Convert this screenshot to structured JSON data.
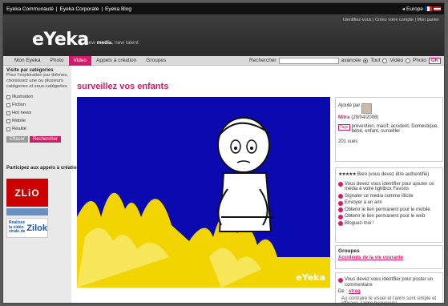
{
  "topbar": {
    "links": [
      "Eyeka Communauté",
      "Eyeka Corporate",
      "Eyeka Blog"
    ],
    "region": "Europe"
  },
  "header": {
    "account_text": "Identifiez-vous | Créez votre compte  | Mon panier",
    "logo": "eYeka",
    "tagline_pre": "new",
    "tagline_b": "media",
    "tagline_post": ", new talent"
  },
  "nav": {
    "tabs": [
      "Mon Eyeka",
      "Photo",
      "Video",
      "Appels à création",
      "Groupes"
    ],
    "search_label": "Rechercher",
    "advanced": "avancée",
    "opts": [
      "Tout",
      "Vidéo",
      "Photo"
    ],
    "ok": "OK"
  },
  "sidebar": {
    "heading": "Visite par catégories",
    "desc": "Pour l'exploration par thèmes, choisissez une ou plusieurs catégories et sous-catégories",
    "cats": [
      "Illustration",
      "Fiction",
      "Hot news",
      "Mobile",
      "Réalité"
    ],
    "reset": "Effacer",
    "search": "Rechercher",
    "appeals": "Participez aux appels à création du moment",
    "ad1": "ZLiO",
    "ad3a": "Réalisez la vidéo virale de",
    "ad3b": "Zilok"
  },
  "main": {
    "title": "surveillez vos enfants",
    "video_watermark": "eYeka"
  },
  "info": {
    "added_by": "Ajouté par",
    "author": "Mitra",
    "date": "(29/04/2008)",
    "tags_badge": "Tags",
    "tags": "prévention, macif, accident, Domestique, bébé, enfant, surveiller",
    "views": "201 vues"
  },
  "actions": {
    "rating_text": "Bien (vous devez être authentifié)",
    "items": [
      "Vous devez vous identifier pour ajouter ce média à votre lightbox Favoris",
      "Signaler ce media comme illicite",
      "Envoyer à un ami",
      "Obtenir le lien permanent pour le mobile",
      "Obtenir le lien permanent pour le web",
      "Bloguez-moi !"
    ]
  },
  "groups": {
    "heading": "Groupes",
    "link": "Accidents de la vie courante"
  },
  "comments": {
    "prompt": "Vous devez vous identifier pour poster un commentaire",
    "from": "De :",
    "user": "strag",
    "text": "Au contraire le visuel et l'anim sont simple et efficace, j'aime beaucoup!"
  }
}
